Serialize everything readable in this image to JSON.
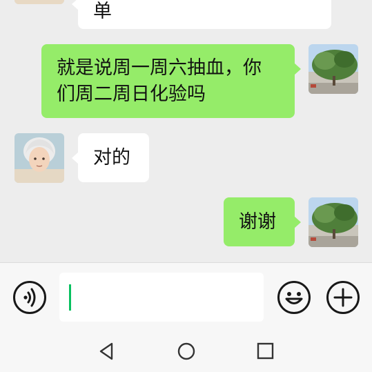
{
  "messages": [
    {
      "side": "in",
      "text": "单"
    },
    {
      "side": "out",
      "text": "就是说周一周六抽血，你们周二周日化验吗",
      "lines": [
        "就是说周一周六抽血，你",
        "们周二周日化验吗"
      ]
    },
    {
      "side": "in",
      "text": "对的"
    },
    {
      "side": "out",
      "text": "谢谢"
    }
  ],
  "composer": {
    "input_value": "",
    "voice_icon": "voice-icon",
    "emoji_icon": "emoji-icon",
    "more_icon": "plus-icon"
  },
  "system_nav": {
    "back_icon": "back-triangle-icon",
    "home_icon": "home-circle-icon",
    "recents_icon": "recents-square-icon"
  },
  "colors": {
    "chat_bg": "#ededed",
    "incoming_bubble": "#ffffff",
    "outgoing_bubble": "#95ec69",
    "caret": "#07c160"
  }
}
